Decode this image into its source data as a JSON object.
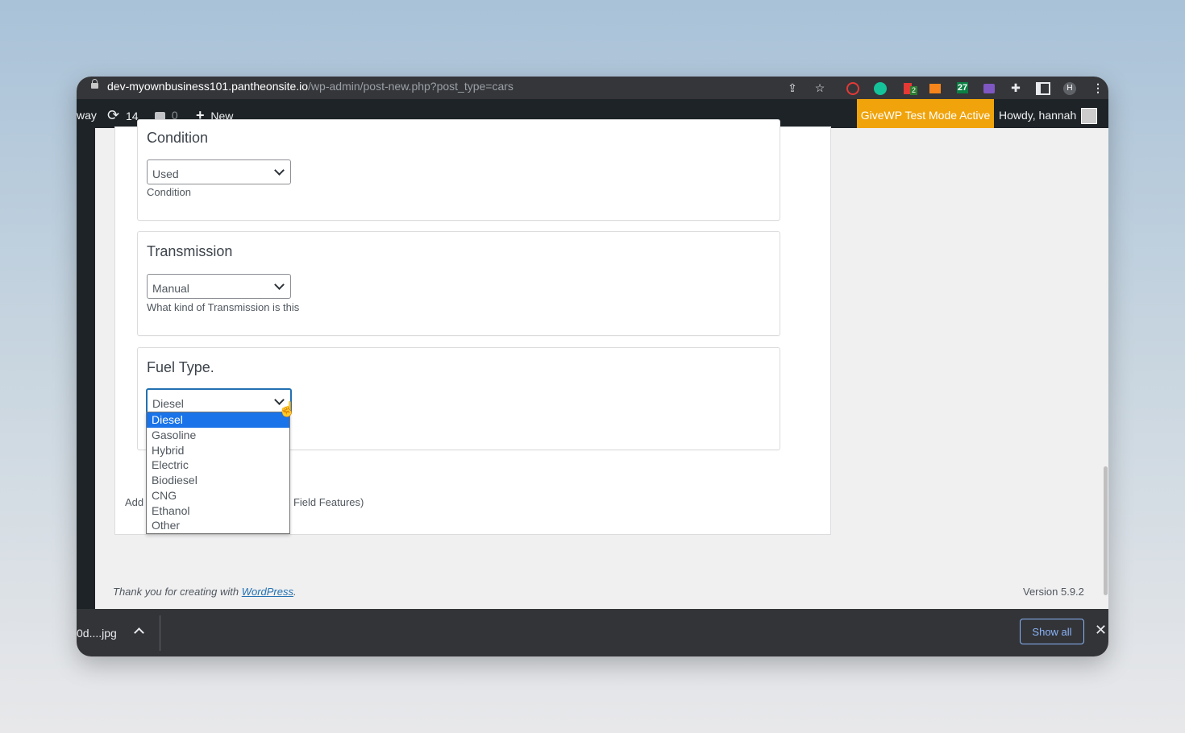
{
  "browser": {
    "url_host": "dev-myownbusiness101.pantheonsite.io",
    "url_path": "/wp-admin/post-new.php?post_type=cars",
    "profile_initial": "H",
    "ext_badge": "2",
    "ext_27": "27"
  },
  "adminbar": {
    "site_fragment": "way",
    "updates_count": "14",
    "comments_count": "0",
    "new_label": "New",
    "givewp_notice": "GiveWP Test Mode Active",
    "howdy": "Howdy, hannah"
  },
  "fields": {
    "condition": {
      "title": "Condition",
      "value": "Used",
      "description": "Condition"
    },
    "transmission": {
      "title": "Transmission",
      "value": "Manual",
      "description": "What kind of Transmission is this"
    },
    "fuel": {
      "title": "Fuel Type.",
      "value": "Diesel",
      "options": [
        "Diesel",
        "Gasoline",
        "Hybrid",
        "Electric",
        "Biodiesel",
        "CNG",
        "Ethanol",
        "Other"
      ],
      "selected_index": 0
    }
  },
  "partial": {
    "left": "Add",
    "right": "- Field Features)"
  },
  "footer": {
    "thanks_prefix": "Thank you for creating with",
    "wordpress_link": "WordPress",
    "thanks_suffix": ".",
    "version": "Version 5.9.2"
  },
  "download": {
    "filename": "0d....jpg",
    "show_all": "Show all"
  }
}
